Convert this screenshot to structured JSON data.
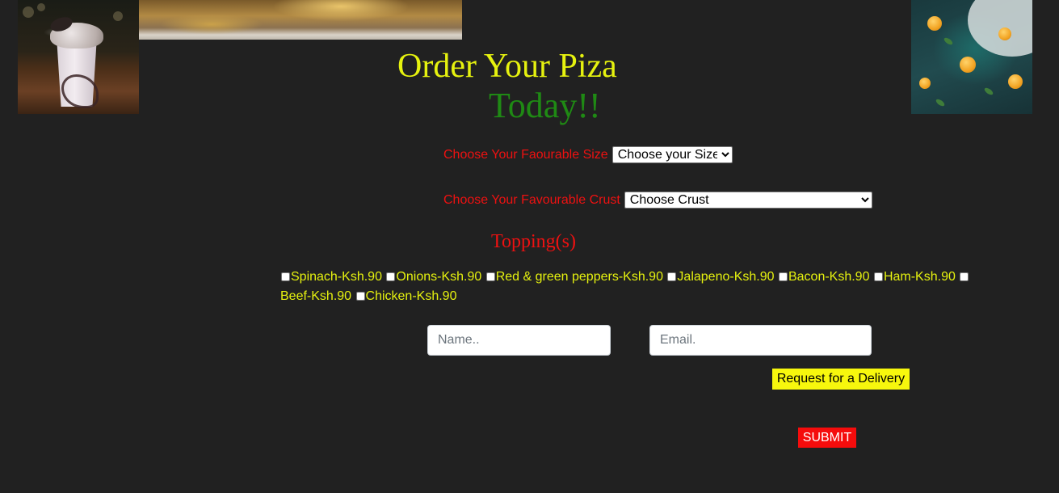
{
  "header": {
    "title": "Order Your Piza",
    "subtitle": "Today!!"
  },
  "images": {
    "left": "milkshake-photo",
    "banner": "pizza-photo",
    "right": "oranges-photo"
  },
  "form": {
    "size": {
      "label": "Choose Your Faourable Size",
      "selected": "Choose your Size"
    },
    "crust": {
      "label": "Choose Your Favourable Crust",
      "selected": "Choose Crust"
    },
    "toppings": {
      "heading": "Topping(s)",
      "items": [
        "Spinach-Ksh.90",
        "Onions-Ksh.90",
        "Red & green peppers-Ksh.90",
        "Jalapeno-Ksh.90",
        "Bacon-Ksh.90",
        "Ham-Ksh.90",
        "Beef-Ksh.90",
        "Chicken-Ksh.90"
      ]
    },
    "name": {
      "placeholder": "Name.."
    },
    "email": {
      "placeholder": "Email."
    },
    "delivery_button": "Request for a Delivery",
    "submit_button": "SUBMIT"
  },
  "colors": {
    "background": "#212121",
    "title": "#e6f20f",
    "subtitle": "#1f8a14",
    "label_red": "#ee1111",
    "topping_text": "#e6f20f",
    "delivery_button_bg": "#f7f70d",
    "submit_button_bg": "#f50c0c"
  }
}
